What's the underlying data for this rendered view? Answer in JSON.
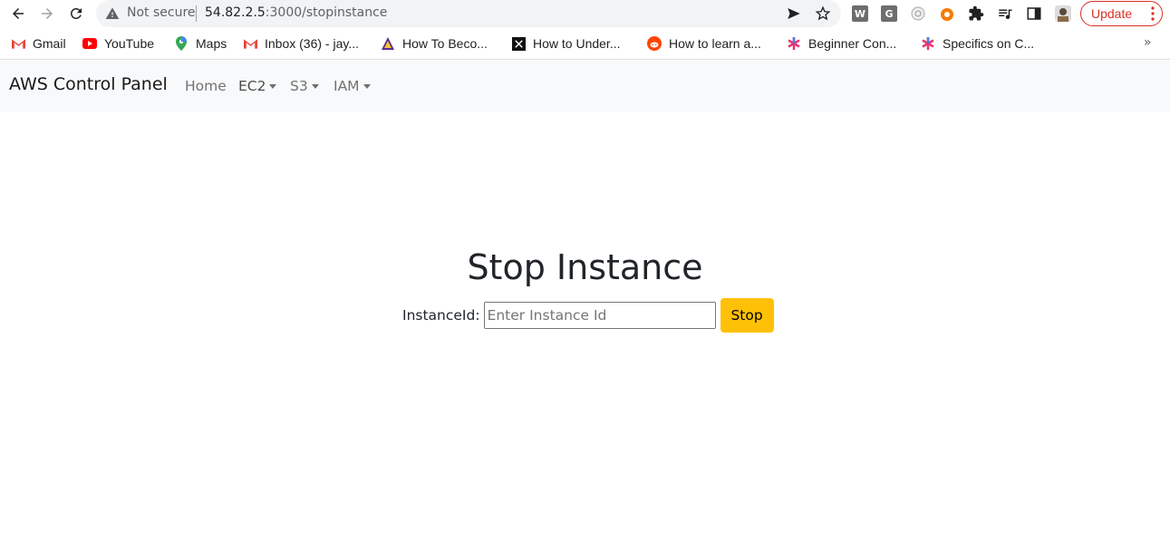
{
  "browser": {
    "security_label": "Not secure",
    "url_host": "54.82.2.5",
    "url_path": ":3000/stopinstance",
    "update_label": "Update",
    "accent": "#d93025"
  },
  "bookmarks": [
    {
      "label": "Gmail",
      "icon": "gmail-icon"
    },
    {
      "label": "YouTube",
      "icon": "youtube-icon"
    },
    {
      "label": "Maps",
      "icon": "maps-icon"
    },
    {
      "label": "Inbox (36) - jay...",
      "icon": "gmail-icon"
    },
    {
      "label": "How To Beco...",
      "icon": "triangle-icon"
    },
    {
      "label": "How to Under...",
      "icon": "square-logo-icon"
    },
    {
      "label": "How to learn a...",
      "icon": "reddit-icon"
    },
    {
      "label": "Beginner Con...",
      "icon": "asterisk-icon"
    },
    {
      "label": "Specifics on C...",
      "icon": "asterisk-icon"
    }
  ],
  "navbar": {
    "brand": "AWS Control Panel",
    "links": [
      "Home",
      "EC2",
      "S3",
      "IAM"
    ]
  },
  "main": {
    "title": "Stop Instance",
    "label": "InstanceId:",
    "placeholder": "Enter Instance Id",
    "button": "Stop",
    "button_color": "#ffc107"
  }
}
